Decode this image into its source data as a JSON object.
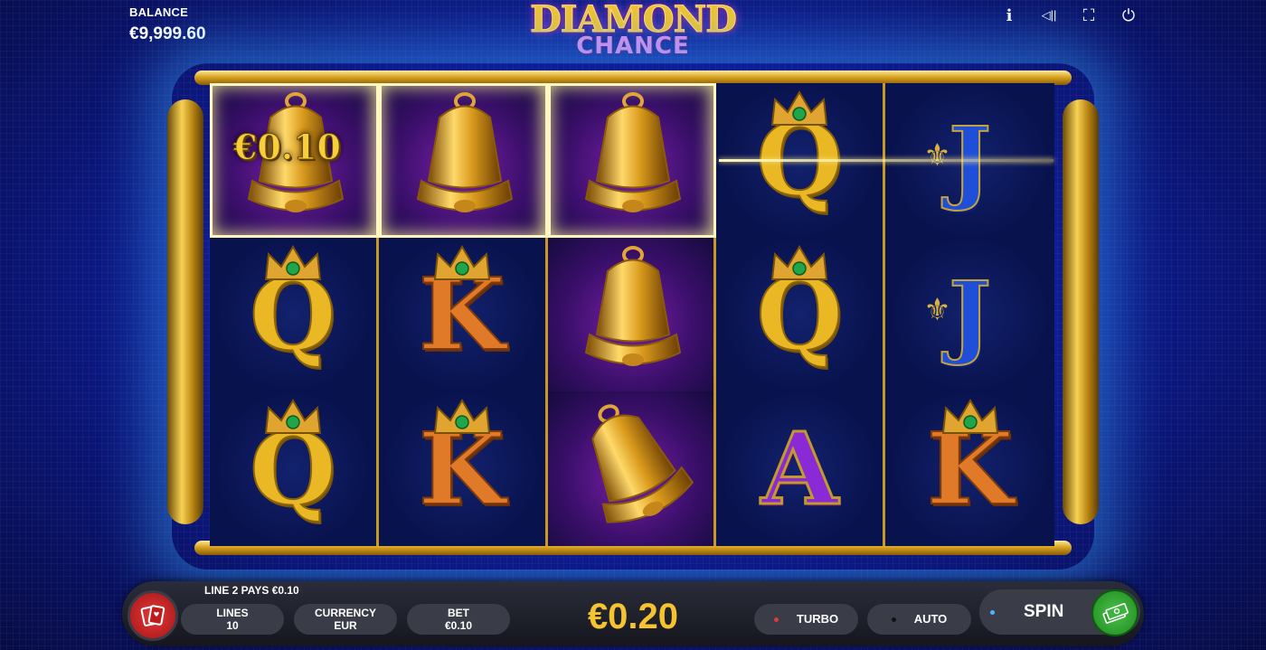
{
  "balance": {
    "label": "BALANCE",
    "value": "€9,999.60"
  },
  "logo": {
    "line1": "DIAMOND",
    "line2": "CHANCE"
  },
  "top_icons": [
    "info-icon",
    "sound-icon",
    "fullscreen-icon",
    "power-icon"
  ],
  "top_icon_glyphs": {
    "info": "i",
    "sound": "◁||",
    "fullscreen": "⛶",
    "power": "⏻"
  },
  "reels": {
    "win_amount": "€0.10",
    "symbols": [
      [
        "bell",
        "bell",
        "bell",
        "Q",
        "J"
      ],
      [
        "Q",
        "K",
        "bell",
        "Q",
        "J"
      ],
      [
        "Q",
        "K",
        "bell",
        "A",
        "K"
      ]
    ],
    "highlighted_cells": [
      [
        0,
        0
      ],
      [
        0,
        1
      ],
      [
        0,
        2
      ]
    ]
  },
  "controls": {
    "line_info": "LINE 2 PAYS €0.10",
    "lines": {
      "label": "LINES",
      "value": "10"
    },
    "currency": {
      "label": "CURRENCY",
      "value": "EUR"
    },
    "bet": {
      "label": "BET",
      "value": "€0.10"
    },
    "total_bet": "€0.20",
    "turbo": "TURBO",
    "auto": "AUTO",
    "spin": "SPIN"
  },
  "colors": {
    "gold": "#f5c330",
    "turbo_dot": "#e03a3a",
    "auto_dot": "#111111",
    "spin_dot": "#4bb6ff"
  }
}
